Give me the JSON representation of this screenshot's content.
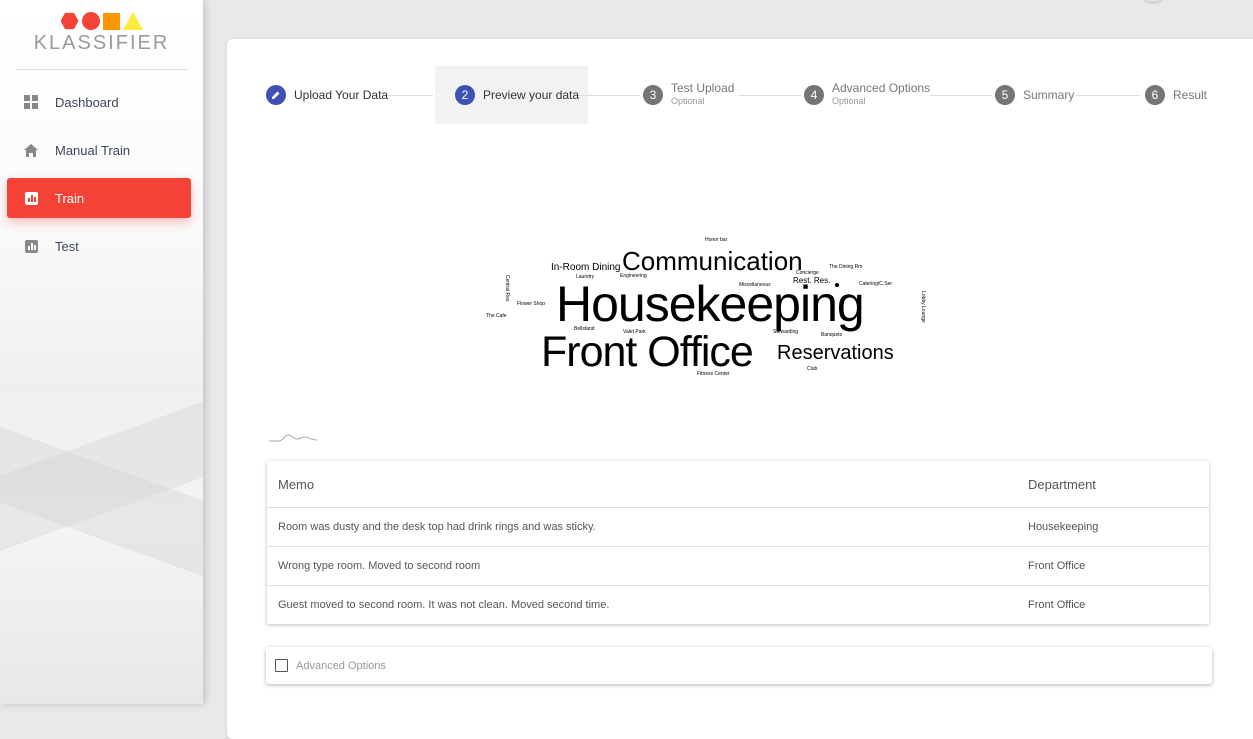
{
  "app": {
    "logo_text": "KLASSIFIER"
  },
  "sidebar": {
    "items": [
      {
        "label": "Dashboard",
        "icon": "dashboard-icon"
      },
      {
        "label": "Manual Train",
        "icon": "home-icon"
      },
      {
        "label": "Train",
        "icon": "bar-chart-icon",
        "active": true
      },
      {
        "label": "Test",
        "icon": "bar-chart-icon"
      }
    ]
  },
  "stepper": {
    "steps": [
      {
        "number": "",
        "label": "Upload Your Data",
        "status": "done",
        "icon": "pencil-icon"
      },
      {
        "number": "2",
        "label": "Preview your data",
        "status": "current"
      },
      {
        "number": "3",
        "label": "Test Upload",
        "optional": "Optional",
        "status": "future"
      },
      {
        "number": "4",
        "label": "Advanced Options",
        "optional": "Optional",
        "status": "future"
      },
      {
        "number": "5",
        "label": "Summary",
        "status": "future"
      },
      {
        "number": "6",
        "label": "Result",
        "status": "future"
      }
    ]
  },
  "wordcloud": {
    "words": [
      {
        "text": "Housekeeping"
      },
      {
        "text": "Front Office"
      },
      {
        "text": "Communication"
      },
      {
        "text": "Reservations"
      },
      {
        "text": "In-Room Dining"
      },
      {
        "text": "Honor bar"
      },
      {
        "text": "Laundry"
      },
      {
        "text": "Engineering"
      },
      {
        "text": "Concierge"
      },
      {
        "text": "Rest. Res."
      },
      {
        "text": "Miscellaneous"
      },
      {
        "text": "The Dining Rm"
      },
      {
        "text": "Catering/C.Ser"
      },
      {
        "text": "Flower Shop"
      },
      {
        "text": "The Cafe"
      },
      {
        "text": "Bellstand"
      },
      {
        "text": "Valet Park"
      },
      {
        "text": "Stewarding"
      },
      {
        "text": "Banquets"
      },
      {
        "text": "Club"
      },
      {
        "text": "Fitness Center"
      },
      {
        "text": "Central Res"
      },
      {
        "text": "Lobby Lounge"
      }
    ]
  },
  "table": {
    "columns": [
      "Memo",
      "Department"
    ],
    "rows": [
      [
        "Room was dusty and the desk top had drink rings and was sticky.",
        "Housekeeping"
      ],
      [
        "Wrong type room. Moved to second room",
        "Front Office"
      ],
      [
        "Guest moved to second room. It was not clean. Moved second time.",
        "Front Office"
      ]
    ]
  },
  "advanced": {
    "label": "Advanced Options",
    "checked": false
  },
  "colors": {
    "accent": "#f44336",
    "step_active": "#3f51b5",
    "step_inactive": "#757575"
  }
}
